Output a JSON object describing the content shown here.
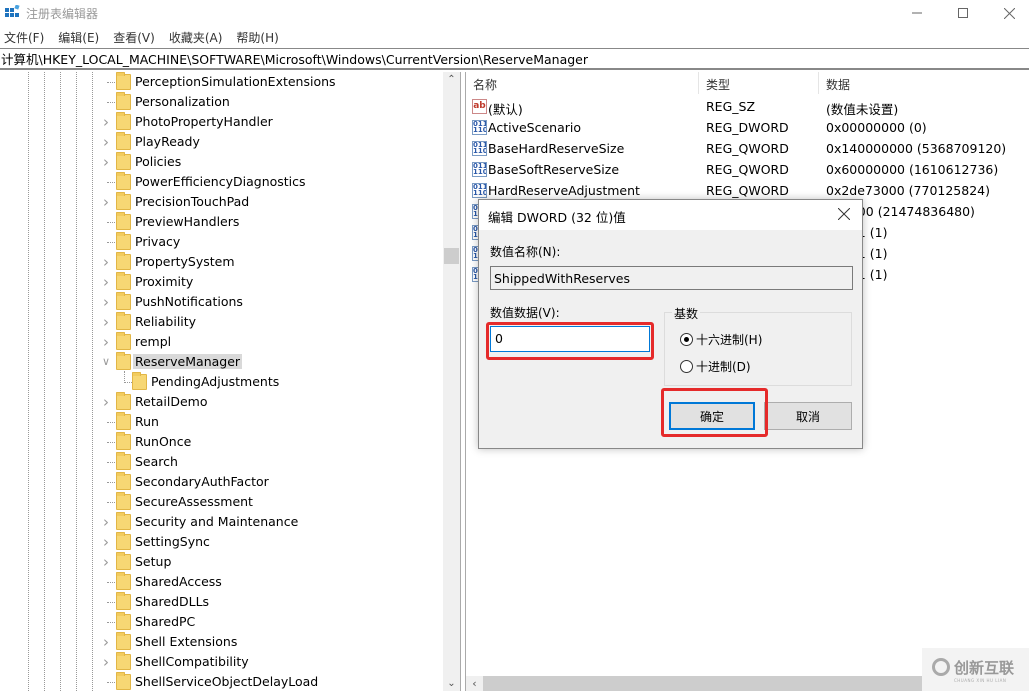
{
  "window": {
    "title": "注册表编辑器",
    "min_icon": "minimize-icon",
    "max_icon": "maximize-icon",
    "close_icon": "close-icon"
  },
  "menu": [
    {
      "label": "文件(F)"
    },
    {
      "label": "编辑(E)"
    },
    {
      "label": "查看(V)"
    },
    {
      "label": "收藏夹(A)"
    },
    {
      "label": "帮助(H)"
    }
  ],
  "address": "计算机\\HKEY_LOCAL_MACHINE\\SOFTWARE\\Microsoft\\Windows\\CurrentVersion\\ReserveManager",
  "tree": {
    "items": [
      {
        "label": "PerceptionSimulationExtensions",
        "expandable": false
      },
      {
        "label": "Personalization",
        "expandable": false
      },
      {
        "label": "PhotoPropertyHandler",
        "expandable": true
      },
      {
        "label": "PlayReady",
        "expandable": true
      },
      {
        "label": "Policies",
        "expandable": true
      },
      {
        "label": "PowerEfficiencyDiagnostics",
        "expandable": false
      },
      {
        "label": "PrecisionTouchPad",
        "expandable": true
      },
      {
        "label": "PreviewHandlers",
        "expandable": false
      },
      {
        "label": "Privacy",
        "expandable": false
      },
      {
        "label": "PropertySystem",
        "expandable": true
      },
      {
        "label": "Proximity",
        "expandable": true
      },
      {
        "label": "PushNotifications",
        "expandable": true
      },
      {
        "label": "Reliability",
        "expandable": true
      },
      {
        "label": "rempl",
        "expandable": true
      },
      {
        "label": "ReserveManager",
        "expandable": true,
        "expanded": true,
        "selected": true
      },
      {
        "label": "PendingAdjustments",
        "expandable": false,
        "child": true
      },
      {
        "label": "RetailDemo",
        "expandable": true
      },
      {
        "label": "Run",
        "expandable": false
      },
      {
        "label": "RunOnce",
        "expandable": false
      },
      {
        "label": "Search",
        "expandable": false
      },
      {
        "label": "SecondaryAuthFactor",
        "expandable": false
      },
      {
        "label": "SecureAssessment",
        "expandable": false
      },
      {
        "label": "Security and Maintenance",
        "expandable": true
      },
      {
        "label": "SettingSync",
        "expandable": true
      },
      {
        "label": "Setup",
        "expandable": true
      },
      {
        "label": "SharedAccess",
        "expandable": false
      },
      {
        "label": "SharedDLLs",
        "expandable": false
      },
      {
        "label": "SharedPC",
        "expandable": false
      },
      {
        "label": "Shell Extensions",
        "expandable": true
      },
      {
        "label": "ShellCompatibility",
        "expandable": true
      },
      {
        "label": "ShellServiceObjectDelayLoad",
        "expandable": false
      }
    ]
  },
  "list": {
    "headers": {
      "name": "名称",
      "type": "类型",
      "data": "数据"
    },
    "rows": [
      {
        "icon": "string-value-icon",
        "name": "(默认)",
        "type": "REG_SZ",
        "data": "(数值未设置)"
      },
      {
        "icon": "binary-value-icon",
        "name": "ActiveScenario",
        "type": "REG_DWORD",
        "data": "0x00000000 (0)"
      },
      {
        "icon": "binary-value-icon",
        "name": "BaseHardReserveSize",
        "type": "REG_QWORD",
        "data": "0x140000000 (5368709120)"
      },
      {
        "icon": "binary-value-icon",
        "name": "BaseSoftReserveSize",
        "type": "REG_QWORD",
        "data": "0x60000000 (1610612736)"
      },
      {
        "icon": "binary-value-icon",
        "name": "HardReserveAdjustment",
        "type": "REG_QWORD",
        "data": "0x2de73000 (770125824)"
      },
      {
        "icon": "binary-value-icon",
        "name": "",
        "type": "",
        "data": "000000 (21474836480)"
      },
      {
        "icon": "binary-value-icon",
        "name": "",
        "type": "",
        "data": "00001 (1)"
      },
      {
        "icon": "binary-value-icon",
        "name": "",
        "type": "",
        "data": "00001 (1)"
      },
      {
        "icon": "binary-value-icon",
        "name": "",
        "type": "",
        "data": "00001 (1)"
      }
    ]
  },
  "dialog": {
    "title": "编辑 DWORD (32 位)值",
    "name_label": "数值名称(N):",
    "name_value": "ShippedWithReserves",
    "data_label": "数值数据(V):",
    "data_value": "0",
    "base_label": "基数",
    "radio_hex": "十六进制(H)",
    "radio_dec": "十进制(D)",
    "selected_base": "hex",
    "ok_label": "确定",
    "cancel_label": "取消",
    "highlight_color": "#e52a2a"
  },
  "watermark": {
    "text": "创新互联",
    "sub": "CHUANG XIN HU LIAN"
  }
}
